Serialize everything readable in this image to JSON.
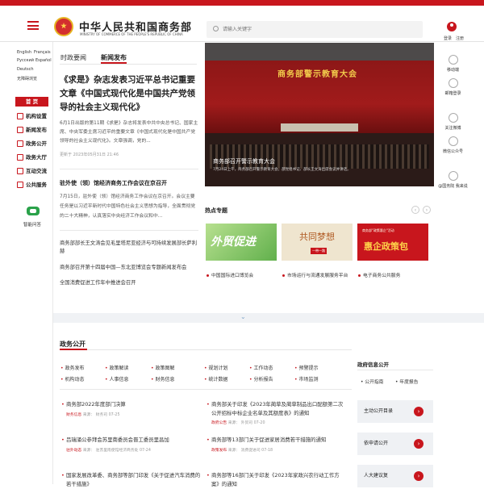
{
  "header": {
    "logo_title": "中华人民共和国商务部",
    "logo_subtitle": "MINISTRY OF COMMERCE OF THE PEOPLE'S REPUBLIC OF CHINA",
    "search_placeholder": "请输入关键字",
    "login": "登录",
    "register": "注册"
  },
  "languages": [
    "English",
    "Français",
    "Русский",
    "Español",
    "Deutsch",
    "无障碍浏览"
  ],
  "leftnav": {
    "home": "首 页",
    "items": [
      "机构设置",
      "新闻发布",
      "政务公开",
      "政务大厅",
      "互动交流",
      "公共服务"
    ],
    "assistant": "智能问答"
  },
  "news": {
    "tabs": [
      "时政要闻",
      "新闻发布"
    ],
    "headline": "《求是》杂志发表习近平总书记重要文章《中国式现代化是中国共产党领导的社会主义现代化》",
    "summary": "6月1日出版的第11期《求是》杂志将发表中共中央总书记、国家主席、中央军委主席习近平的重要文章《中国式现代化是中国共产党领导的社会主义现代化》。文章强调，党的...",
    "date": "更新于 2023年05月31日 21:46",
    "second_title": "驻外使（领）馆经济商务工作会议在京召开",
    "second_summary": "7月15日，驻外使（领）馆经济商务工作会议在京召开。会议主要任务是以习近平新时代中国特色社会主义思想为指导，全面贯彻党的二十大精神，认真落实中央经济工作会议和中...",
    "items": [
      "商务部部长王文涛会见毛里塔尼亚经济与可持续发展部长萨利赫",
      "商务部召开第十四届中国—东北亚博览会专题新闻发布会",
      "全国消费促进工作年中推进会召开"
    ]
  },
  "hero": {
    "banner": "商务部警示教育大会",
    "caption": "商务部召开警示教育大会",
    "subcaption": "7月24日上午，商务部召开警示教育大会，部党组书记、部长王文涛出席会议并讲话。"
  },
  "hot": {
    "title": "热点专题",
    "promos": [
      {
        "text": "外贸促进"
      },
      {
        "text": "共同梦想",
        "badge": "一带一路"
      },
      {
        "text": "惠企政策包",
        "top": "商务部\"政策惠企\"活动"
      }
    ],
    "links": [
      "中国国际进口博览会",
      "市场运行与流通发展服务平台",
      "电子商务公共服务"
    ]
  },
  "rightrail": [
    "移动端",
    "邮箱登录",
    "关注微博",
    "微信公众号",
    "@国务院 我来说"
  ],
  "gov": {
    "title": "政务公开",
    "links": [
      [
        "政务发布",
        "政策解读",
        "政策图解",
        "规划计划",
        "工作动态",
        "预警提示"
      ],
      [
        "机构动态",
        "人事信息",
        "财务信息",
        "统计数据",
        "分析报告",
        "市场监测"
      ]
    ],
    "articles": [
      {
        "title": "商务部2022年度部门决算",
        "tag": "财务信息",
        "source": "来源： 财务司",
        "date": "07-25"
      },
      {
        "title": "商务部关于印发《2023年蔺草及蔺草制品出口配额第二次公开招标中标企业名单及其额度表》的通知",
        "tag": "政府公告",
        "source": "来源： 外贸司",
        "date": "07-20"
      },
      {
        "title": "吕瑞涌公参拜会苏里南委员会晋工委员里昌加",
        "tag": "驻外动态",
        "source": "来源： 驻苏里南使馆经济商务处",
        "date": "07-24"
      },
      {
        "title": "商务部等13部门关于促进家居消费若干措施的通知",
        "tag": "政策发布",
        "source": "来源： 消费促进司",
        "date": "07-18"
      },
      {
        "title": "国家发展改革委、商务部等部门印发《关于促进汽车消费的若干措施》",
        "tag": "",
        "source": "",
        "date": ""
      },
      {
        "title": "商务部等16部门关于印发《2023年家政兴农行动工作方案》的通知",
        "tag": "",
        "source": "",
        "date": ""
      }
    ]
  },
  "side": {
    "title": "政府信息公开",
    "tabs": [
      "公开指南",
      "年度报告"
    ],
    "buttons": [
      "主动公开目录",
      "依申请公开",
      "人大建议复"
    ]
  },
  "colors": {
    "accent": "#c8161d"
  }
}
